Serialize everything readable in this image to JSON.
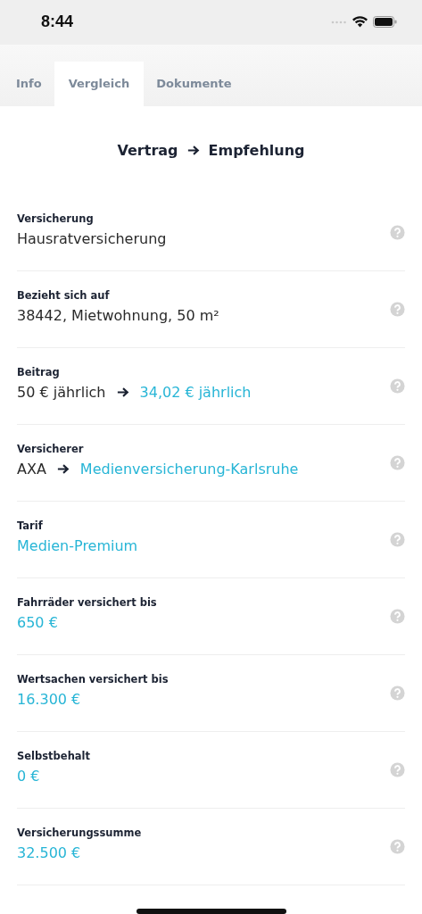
{
  "status_bar": {
    "time": "8:44"
  },
  "tabs": [
    {
      "label": "Info",
      "selected": false
    },
    {
      "label": "Vergleich",
      "selected": true
    },
    {
      "label": "Dokumente",
      "selected": false
    }
  ],
  "header": {
    "from": "Vertrag",
    "to": "Empfehlung"
  },
  "rows": [
    {
      "label": "Versicherung",
      "current": "Hausratversicherung"
    },
    {
      "label": "Bezieht sich auf",
      "current": "38442, Mietwohnung, 50 m²"
    },
    {
      "label": "Beitrag",
      "current": "50 € jährlich",
      "recommended": "34,02 € jährlich"
    },
    {
      "label": "Versicherer",
      "current": "AXA",
      "recommended": "Medienversicherung-Karlsruhe"
    },
    {
      "label": "Tarif",
      "recommended": "Medien-Premium"
    },
    {
      "label": "Fahrräder versichert bis",
      "recommended": "650 €"
    },
    {
      "label": "Wertsachen versichert bis",
      "recommended": "16.300 €"
    },
    {
      "label": "Selbstbehalt",
      "recommended": "0 €"
    },
    {
      "label": "Versicherungssumme",
      "recommended": "32.500 €"
    }
  ]
}
